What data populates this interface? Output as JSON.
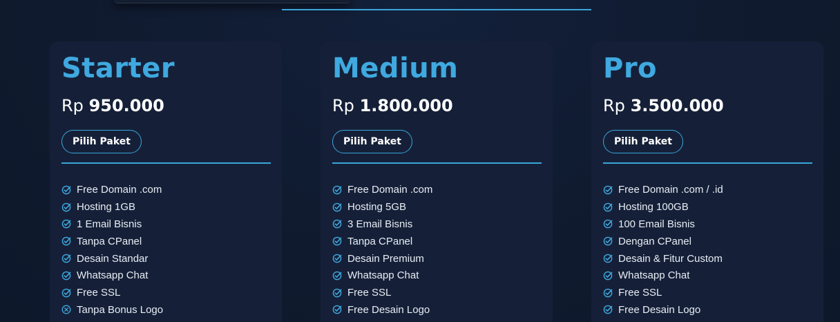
{
  "accent_color": "#3fa9e0",
  "cards": [
    {
      "name": "Starter",
      "price_currency": "Rp",
      "price_amount": "950.000",
      "button_label": "Pilih Paket",
      "features": [
        {
          "text": "Free Domain .com",
          "icon": "check-circle-icon"
        },
        {
          "text": "Hosting 1GB",
          "icon": "check-circle-icon"
        },
        {
          "text": "1 Email Bisnis",
          "icon": "check-circle-icon"
        },
        {
          "text": "Tanpa CPanel",
          "icon": "check-circle-icon"
        },
        {
          "text": "Desain Standar",
          "icon": "check-circle-icon"
        },
        {
          "text": "Whatsapp Chat",
          "icon": "check-circle-icon"
        },
        {
          "text": "Free SSL",
          "icon": "check-circle-icon"
        },
        {
          "text": "Tanpa Bonus Logo",
          "icon": "x-circle-icon"
        }
      ]
    },
    {
      "name": "Medium",
      "price_currency": "Rp",
      "price_amount": "1.800.000",
      "button_label": "Pilih Paket",
      "features": [
        {
          "text": "Free Domain .com",
          "icon": "check-circle-icon"
        },
        {
          "text": "Hosting 5GB",
          "icon": "check-circle-icon"
        },
        {
          "text": "3 Email Bisnis",
          "icon": "check-circle-icon"
        },
        {
          "text": "Tanpa CPanel",
          "icon": "check-circle-icon"
        },
        {
          "text": "Desain Premium",
          "icon": "check-circle-icon"
        },
        {
          "text": "Whatsapp Chat",
          "icon": "check-circle-icon"
        },
        {
          "text": "Free SSL",
          "icon": "check-circle-icon"
        },
        {
          "text": "Free Desain Logo",
          "icon": "check-circle-icon"
        }
      ]
    },
    {
      "name": "Pro",
      "price_currency": "Rp",
      "price_amount": "3.500.000",
      "button_label": "Pilih Paket",
      "features": [
        {
          "text": "Free Domain .com / .id",
          "icon": "check-circle-icon"
        },
        {
          "text": "Hosting 100GB",
          "icon": "check-circle-icon"
        },
        {
          "text": "100 Email Bisnis",
          "icon": "check-circle-icon"
        },
        {
          "text": "Dengan CPanel",
          "icon": "check-circle-icon"
        },
        {
          "text": "Desain & Fitur Custom",
          "icon": "check-circle-icon"
        },
        {
          "text": "Whatsapp Chat",
          "icon": "check-circle-icon"
        },
        {
          "text": "Free SSL",
          "icon": "check-circle-icon"
        },
        {
          "text": "Free Desain Logo",
          "icon": "check-circle-icon"
        }
      ]
    }
  ]
}
